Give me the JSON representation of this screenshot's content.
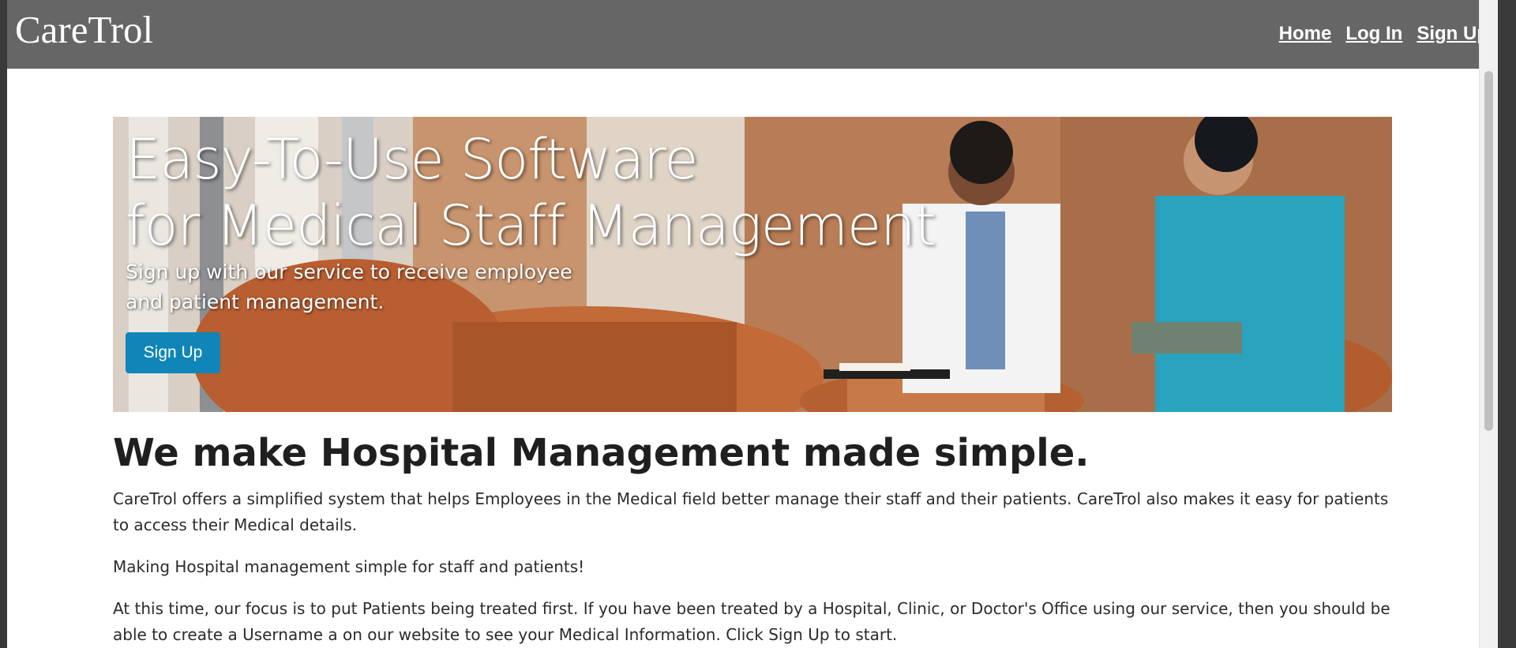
{
  "header": {
    "brand": "CareTrol",
    "nav": [
      "Home",
      "Log In",
      "Sign Up"
    ]
  },
  "hero": {
    "title_line1": "Easy-To-Use Software",
    "title_line2": "for Medical Staff Management",
    "subtitle_line1": "Sign up with our service to receive employee",
    "subtitle_line2": "and patient management.",
    "button_label": "Sign Up"
  },
  "main": {
    "heading": "We make Hospital Management made simple.",
    "paragraphs": [
      "CareTrol offers a simplified system that helps Employees in the Medical field better manage their staff and their patients. CareTrol also makes it easy for patients to access their Medical details.",
      "Making Hospital management simple for staff and patients!",
      "At this time, our focus is to put Patients being treated first. If you have been treated by a Hospital, Clinic, or Doctor's Office using our service, then you should be able to create a Username a on our website to see your Medical Information. Click Sign Up to start."
    ]
  },
  "colors": {
    "navbar_bg": "#666666",
    "button_bg": "#1086b8",
    "page_bg": "#ffffff"
  }
}
